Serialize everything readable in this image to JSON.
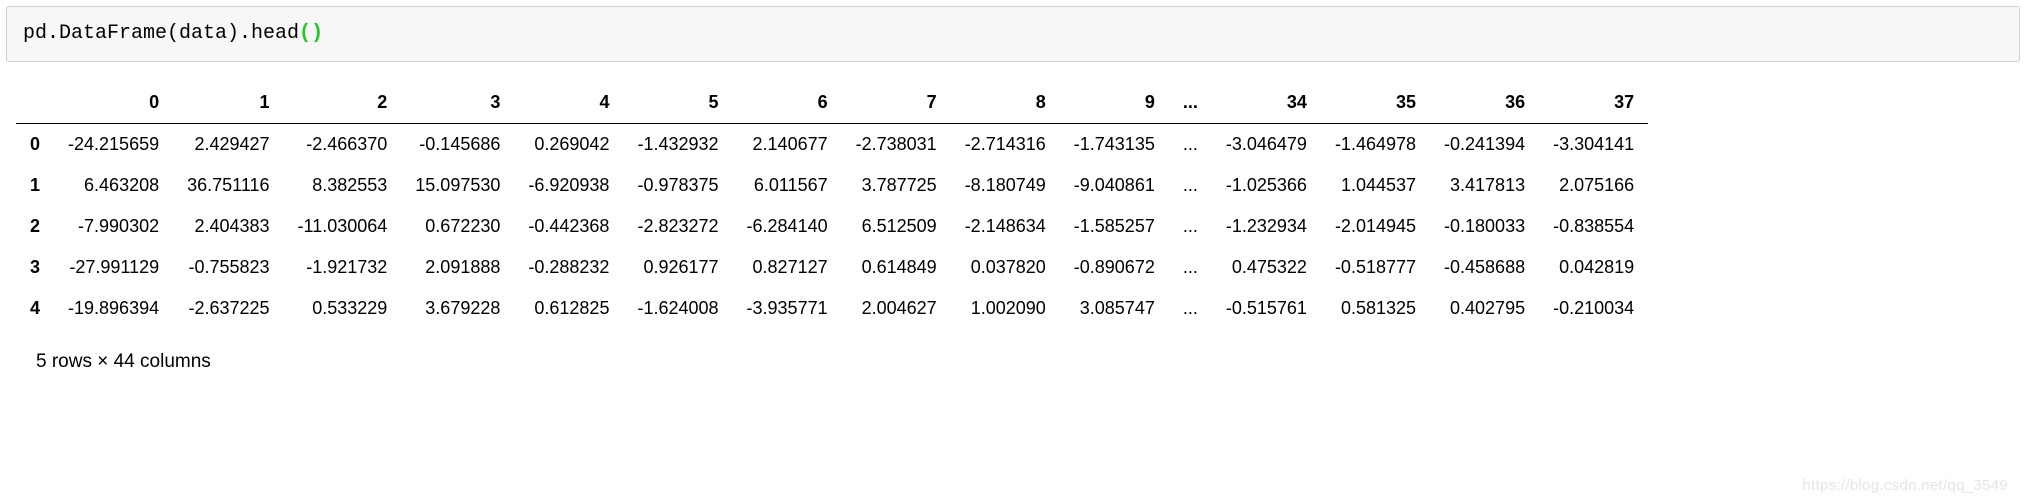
{
  "code": {
    "prefix": "pd.DataFrame(data).head",
    "paren_open": "(",
    "paren_close": ")"
  },
  "table": {
    "columns": [
      "0",
      "1",
      "2",
      "3",
      "4",
      "5",
      "6",
      "7",
      "8",
      "9",
      "...",
      "34",
      "35",
      "36",
      "37"
    ],
    "index": [
      "0",
      "1",
      "2",
      "3",
      "4"
    ],
    "rows": [
      [
        "-24.215659",
        "2.429427",
        "-2.466370",
        "-0.145686",
        "0.269042",
        "-1.432932",
        "2.140677",
        "-2.738031",
        "-2.714316",
        "-1.743135",
        "...",
        "-3.046479",
        "-1.464978",
        "-0.241394",
        "-3.304141"
      ],
      [
        "6.463208",
        "36.751116",
        "8.382553",
        "15.097530",
        "-6.920938",
        "-0.978375",
        "6.011567",
        "3.787725",
        "-8.180749",
        "-9.040861",
        "...",
        "-1.025366",
        "1.044537",
        "3.417813",
        "2.075166"
      ],
      [
        "-7.990302",
        "2.404383",
        "-11.030064",
        "0.672230",
        "-0.442368",
        "-2.823272",
        "-6.284140",
        "6.512509",
        "-2.148634",
        "-1.585257",
        "...",
        "-1.232934",
        "-2.014945",
        "-0.180033",
        "-0.838554"
      ],
      [
        "-27.991129",
        "-0.755823",
        "-1.921732",
        "2.091888",
        "-0.288232",
        "0.926177",
        "0.827127",
        "0.614849",
        "0.037820",
        "-0.890672",
        "...",
        "0.475322",
        "-0.518777",
        "-0.458688",
        "0.042819"
      ],
      [
        "-19.896394",
        "-2.637225",
        "0.533229",
        "3.679228",
        "0.612825",
        "-1.624008",
        "-3.935771",
        "2.004627",
        "1.002090",
        "3.085747",
        "...",
        "-0.515761",
        "0.581325",
        "0.402795",
        "-0.210034"
      ]
    ]
  },
  "summary": "5 rows × 44 columns",
  "watermark": "https://blog.csdn.net/qq_3549"
}
